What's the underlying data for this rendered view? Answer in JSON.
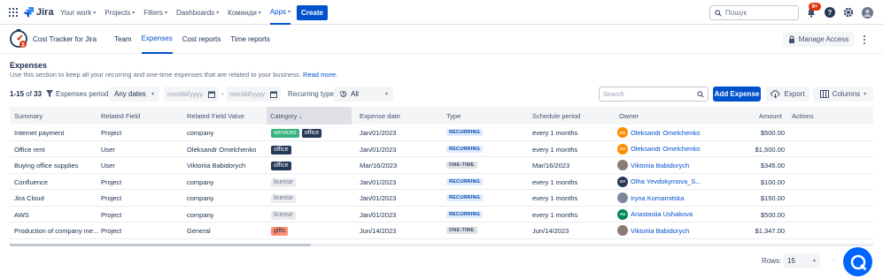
{
  "topnav": {
    "product": "Jira",
    "links": [
      {
        "label": "Your work",
        "active": false
      },
      {
        "label": "Projects",
        "active": false
      },
      {
        "label": "Filters",
        "active": false
      },
      {
        "label": "Dashboards",
        "active": false
      },
      {
        "label": "Команди",
        "active": false
      },
      {
        "label": "Apps",
        "active": true
      }
    ],
    "create_label": "Create",
    "search_placeholder": "Пошук",
    "notif_count": "9+",
    "colors": {
      "brand": "#0052cc"
    }
  },
  "app": {
    "title": "Cost Tracker for Jira",
    "tabs": [
      {
        "label": "Team",
        "active": false
      },
      {
        "label": "Expenses",
        "active": true
      },
      {
        "label": "Cost reports",
        "active": false
      },
      {
        "label": "Time reports",
        "active": false
      }
    ],
    "manage_label": "Manage Access"
  },
  "section": {
    "title": "Expenses",
    "description": "Use this section to keep all your recurring and one-time expenses that are related to your business.",
    "link": "Read more."
  },
  "filters": {
    "count_range": "1-15",
    "count_of": "of",
    "count_total": "33",
    "period_label": "Expenses period:",
    "period_value": "Any dates",
    "date_placeholder_from": "mm/dd/yyyy",
    "date_sep": "-",
    "date_placeholder_to": "mm/dd/yyyy",
    "recurring_label": "Recurring type:",
    "recurring_value": "All",
    "search_placeholder": "Search",
    "add_label": "Add Expense",
    "export_label": "Export",
    "columns_label": "Columns"
  },
  "table": {
    "headers": [
      "Summary",
      "Related Field",
      "Related Field Value",
      "Category",
      "Expense date",
      "Type",
      "Schedule period",
      "Owner",
      "Amount",
      "Actions"
    ],
    "rows": [
      {
        "summary": "Internet payment",
        "field": "Project",
        "value": "company",
        "value_link": false,
        "tags": [
          "services",
          "office"
        ],
        "date": "Jan/01/2023",
        "type": "RECURRING",
        "schedule": "every 1 months",
        "owner": "Oleksandr Omelchenko",
        "owner_initials": "OO",
        "owner_color": "#ff8b00",
        "amount": "$500.00"
      },
      {
        "summary": "Office rent",
        "field": "User",
        "value": "Oleksandr Omelchenko",
        "value_link": false,
        "tags": [
          "office"
        ],
        "date": "Jan/01/2023",
        "type": "RECURRING",
        "schedule": "every 1 months",
        "owner": "Oleksandr Omelchenko",
        "owner_initials": "OO",
        "owner_color": "#ff8b00",
        "amount": "$1,500.00"
      },
      {
        "summary": "Buying office supplies",
        "field": "User",
        "value": "Viktoriia Babidorych",
        "value_link": false,
        "tags": [
          "office"
        ],
        "date": "Mar/16/2023",
        "type": "ONE-TIME",
        "schedule": "Mar/16/2023",
        "owner": "Viktoriia Babidorych",
        "owner_initials": "",
        "owner_color": "#8c7b75",
        "amount": "$345.00"
      },
      {
        "summary": "Confluence",
        "field": "Project",
        "value": "company",
        "value_link": false,
        "tags": [
          "license"
        ],
        "date": "Jan/01/2023",
        "type": "RECURRING",
        "schedule": "every 1 months",
        "owner": "Olha Yevdokymova_S...",
        "owner_initials": "OY",
        "owner_color": "#253858",
        "amount": "$100.00"
      },
      {
        "summary": "Jira Cloud",
        "field": "Project",
        "value": "company",
        "value_link": false,
        "tags": [
          "license"
        ],
        "date": "Jan/01/2023",
        "type": "RECURRING",
        "schedule": "every 1 months",
        "owner": "Iryna Komarnitska",
        "owner_initials": "",
        "owner_color": "#7a869a",
        "amount": "$150.00"
      },
      {
        "summary": "AWS",
        "field": "Project",
        "value": "company",
        "value_link": false,
        "tags": [
          "license"
        ],
        "date": "Jan/01/2023",
        "type": "RECURRING",
        "schedule": "every 1 months",
        "owner": "Anastasiia Ushakova",
        "owner_initials": "AU",
        "owner_color": "#00875a",
        "amount": "$500.00"
      },
      {
        "summary": "Production of company me...",
        "field": "Project",
        "value": "General",
        "value_link": false,
        "tags": [
          "gifts"
        ],
        "date": "Jun/14/2023",
        "type": "ONE-TIME",
        "schedule": "Jun/14/2023",
        "owner": "Viktoriia Babidorych",
        "owner_initials": "",
        "owner_color": "#8c7b75",
        "amount": "$1,347.00"
      }
    ]
  },
  "footer": {
    "rows_label": "Rows:",
    "rows_value": "15"
  }
}
